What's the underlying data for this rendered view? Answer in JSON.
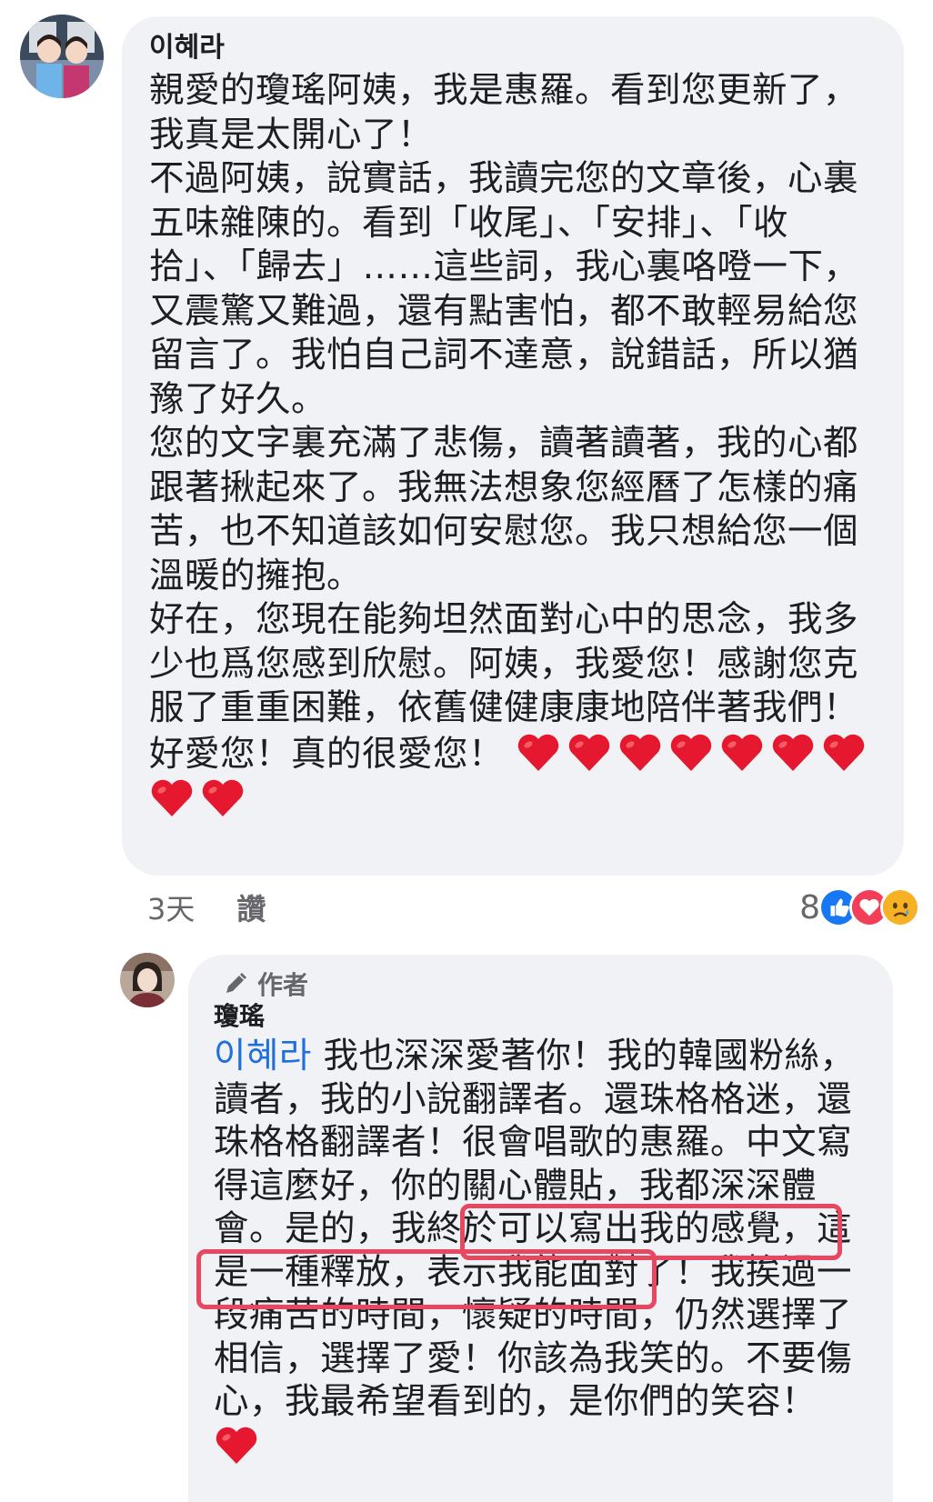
{
  "comment": {
    "author": "이혜라",
    "paragraphs": [
      "親愛的瓊瑤阿姨，我是惠羅。看到您更新了，我真是太開心了！",
      "不過阿姨，說實話，我讀完您的文章後，心裏五味雜陳的。看到「收尾」、「安排」、「收拾」、「歸去」……這些詞，我心裏咯噔一下，又震驚又難過，還有點害怕，都不敢輕易給您留言了。我怕自己詞不達意，說錯話，所以猶豫了好久。",
      "您的文字裏充滿了悲傷，讀著讀著，我的心都跟著揪起來了。我無法想象您經曆了怎樣的痛苦，也不知道該如何安慰您。我只想給您一個溫暖的擁抱。",
      "好在，您現在能夠坦然面對心中的思念，我多少也爲您感到欣慰。阿姨，我愛您！感謝您克服了重重困難，依舊健健康康地陪伴著我們！",
      "好愛您！真的很愛您！"
    ],
    "hearts_count": 9,
    "time": "3天",
    "like_label": "讚",
    "reaction_count": "8",
    "reactions": [
      "like-icon",
      "love-icon",
      "sad-icon"
    ]
  },
  "reply": {
    "badge": "作者",
    "author": "瓊瑤",
    "mention": "이혜라",
    "text_before_highlight": " 我也深深愛著你！我的韓國粉絲，讀者，我的小說翻譯者。還珠格格迷，還珠格格翻譯者！很會唱歌的惠羅。中文寫得這麼好，你的關心體貼，我都深深體會。",
    "highlight_text": "是的，我終於可以寫出我的感覺，這是一種釋放，",
    "text_after_highlight": "表示我能面對了！我挨過一段痛苦的時間，懷疑的時間，仍然選擇了相信，選擇了愛！你該為我笑的。不要傷心，我最希望看到的，是你們的笑容！",
    "hearts_count": 1
  },
  "colors": {
    "bubble": "#f0f2f5",
    "text": "#1c1e21",
    "muted": "#65676b",
    "mention": "#216fdb",
    "heart": "#e5182f",
    "highlight": "#e8475f",
    "like": "#1877f2",
    "love": "#f33e58",
    "sad": "#f7b125"
  }
}
